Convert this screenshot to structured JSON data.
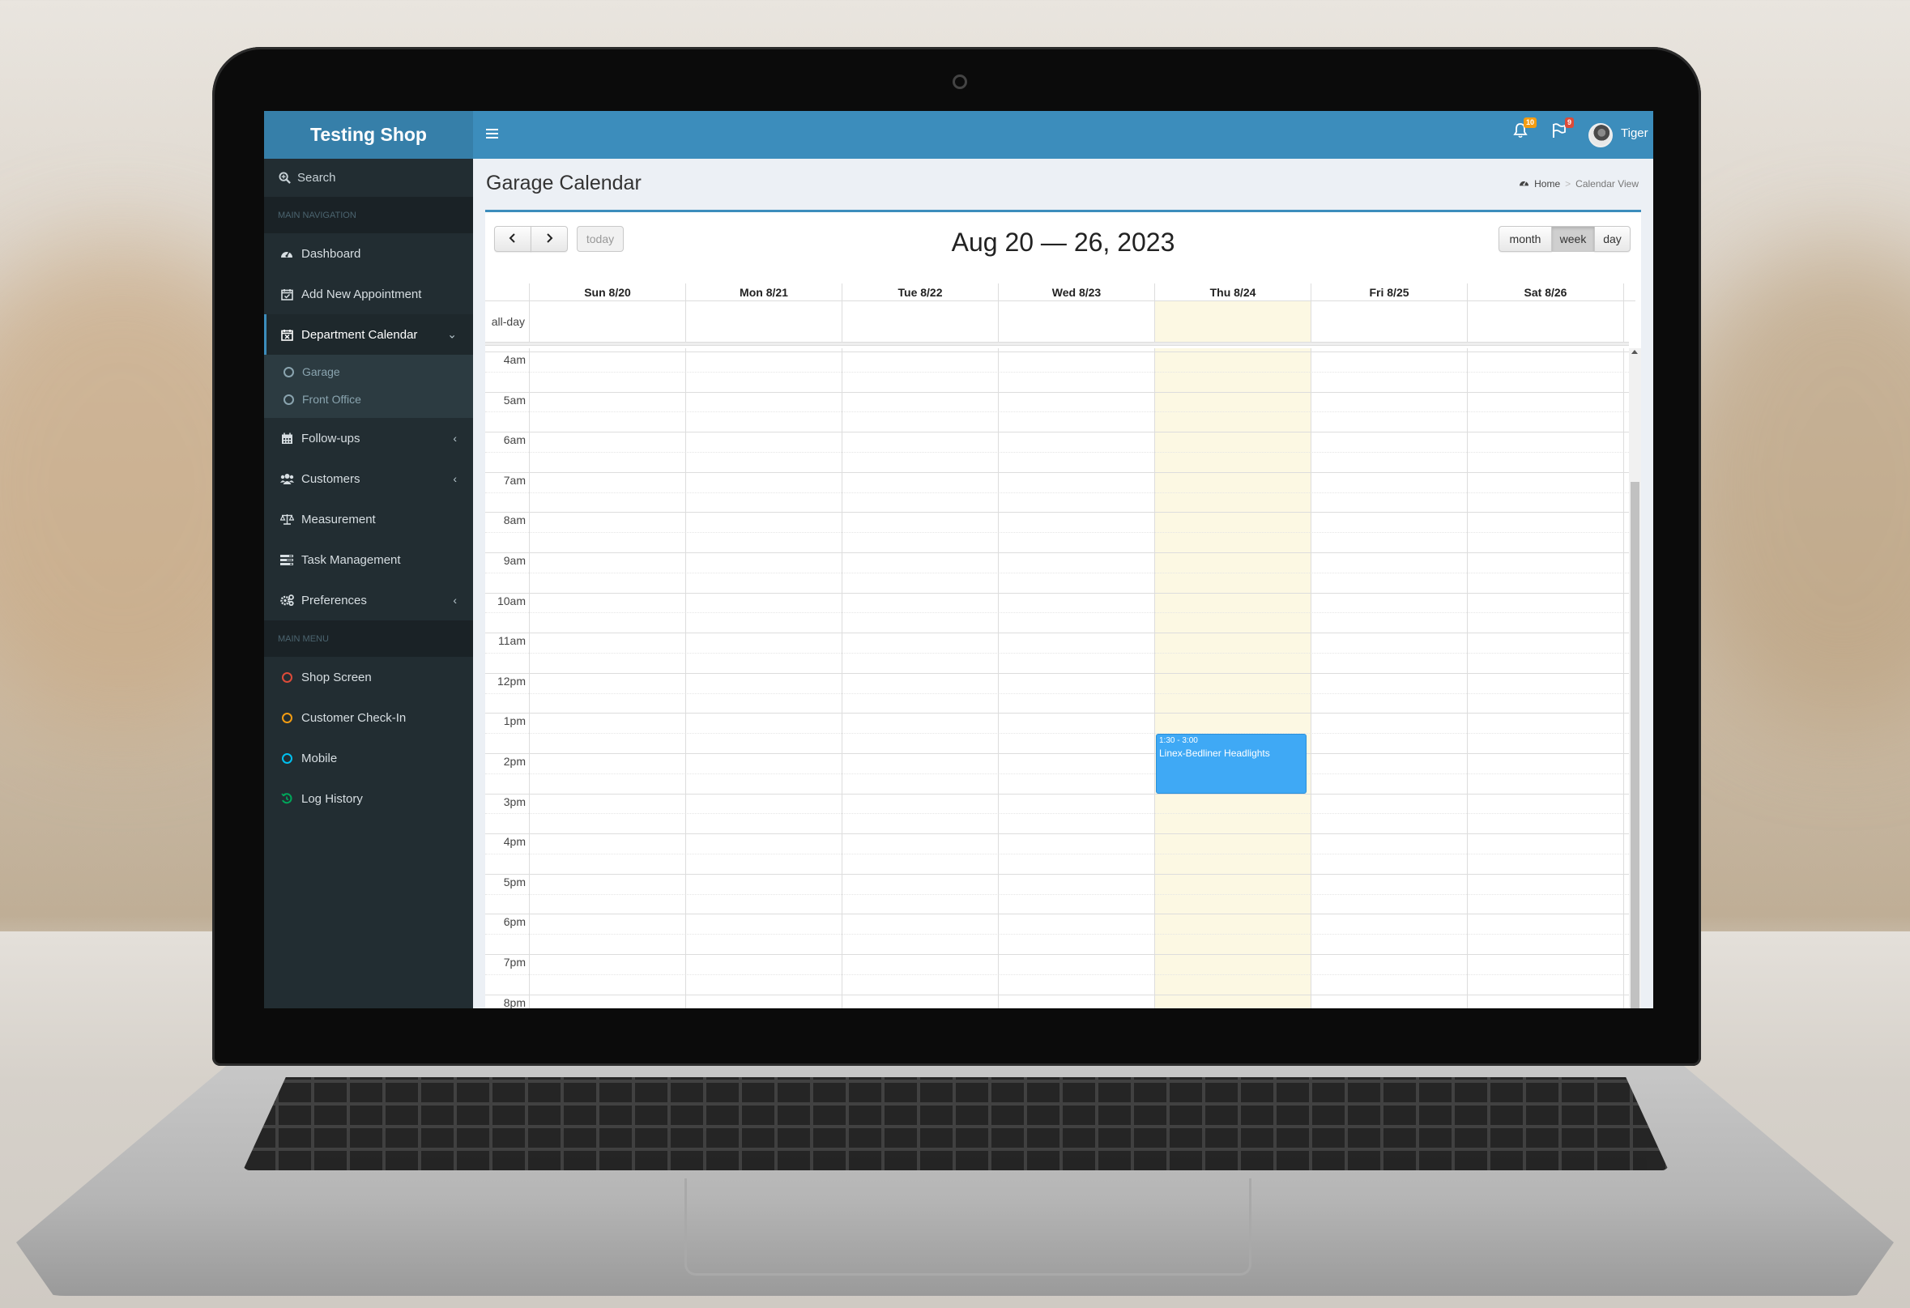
{
  "app": {
    "brand": "Testing Shop",
    "accent_color": "#3c8dbc",
    "sidebar_color": "#222d32"
  },
  "header": {
    "menu_icon": "hamburger-icon",
    "notifications": {
      "icon": "bell-icon",
      "count": "10",
      "badge_color": "#f39c12"
    },
    "flags": {
      "icon": "flag-icon",
      "count": "9",
      "badge_color": "#dd4b39"
    },
    "user": {
      "name": "Tiger",
      "avatar": "user-avatar"
    }
  },
  "sidebar": {
    "search_label": "Search",
    "sections": [
      {
        "header": "MAIN NAVIGATION"
      },
      {
        "header": "MAIN MENU"
      }
    ],
    "nav_items": [
      {
        "label": "Dashboard",
        "icon": "dashboard-icon"
      },
      {
        "label": "Add New Appointment",
        "icon": "calendar-check-icon"
      },
      {
        "label": "Department Calendar",
        "icon": "calendar-x-icon",
        "expanded": true,
        "children": [
          {
            "label": "Garage"
          },
          {
            "label": "Front Office"
          }
        ]
      },
      {
        "label": "Follow-ups",
        "icon": "calendar-icon",
        "has_submenu": true
      },
      {
        "label": "Customers",
        "icon": "users-icon",
        "has_submenu": true
      },
      {
        "label": "Measurement",
        "icon": "balance-scale-icon"
      },
      {
        "label": "Task Management",
        "icon": "tasks-icon"
      },
      {
        "label": "Preferences",
        "icon": "cogs-icon",
        "has_submenu": true
      }
    ],
    "menu_items": [
      {
        "label": "Shop Screen",
        "color": "#dd4b39"
      },
      {
        "label": "Customer Check-In",
        "color": "#f39c12"
      },
      {
        "label": "Mobile",
        "color": "#00c0ef"
      },
      {
        "label": "Log History",
        "color": "#00a65a",
        "icon": "history-icon"
      }
    ]
  },
  "content": {
    "title": "Garage Calendar",
    "breadcrumb": {
      "home": "Home",
      "separator": ">",
      "current": "Calendar View"
    }
  },
  "calendar": {
    "range_title": "Aug 20 — 26, 2023",
    "prev_icon": "chevron-left-icon",
    "next_icon": "chevron-right-icon",
    "today_label": "today",
    "views": [
      "month",
      "week",
      "day"
    ],
    "active_view": "week",
    "days": [
      "Sun 8/20",
      "Mon 8/21",
      "Tue 8/22",
      "Wed 8/23",
      "Thu 8/24",
      "Fri 8/25",
      "Sat 8/26"
    ],
    "today_index": 4,
    "today_color": "#fcf8e3",
    "all_day_label": "all-day",
    "hours": [
      "4am",
      "5am",
      "6am",
      "7am",
      "8am",
      "9am",
      "10am",
      "11am",
      "12pm",
      "1pm",
      "2pm",
      "3pm",
      "4pm",
      "5pm",
      "6pm",
      "7pm",
      "8pm"
    ],
    "first_hour": 4,
    "events": [
      {
        "day_index": 4,
        "start": 13.5,
        "end": 15.0,
        "time": "1:30 - 3:00",
        "title": "Linex-Bedliner Headlights",
        "color": "#3fa9f5"
      }
    ]
  }
}
